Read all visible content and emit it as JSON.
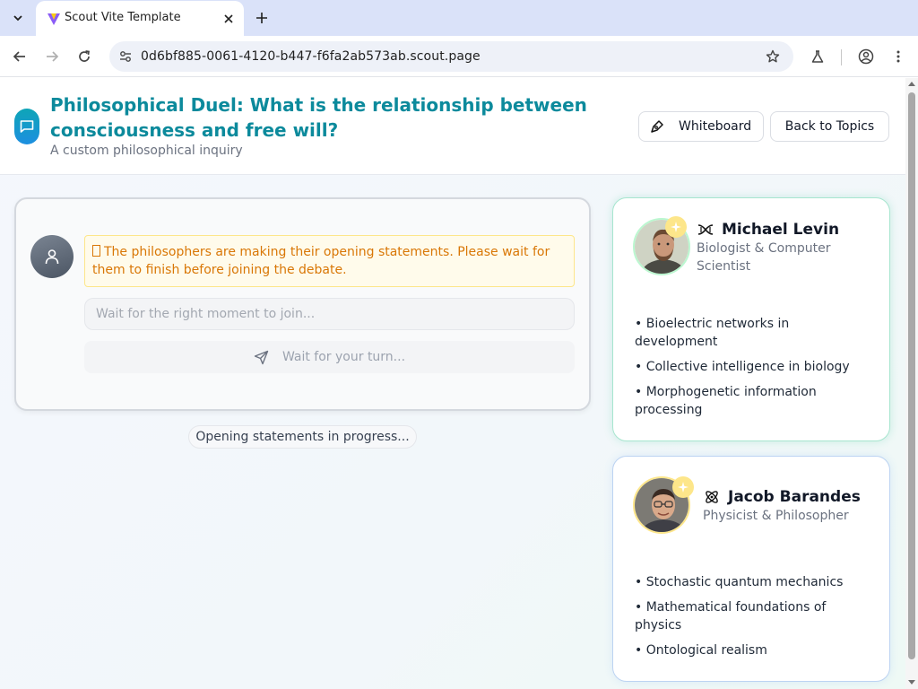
{
  "browser": {
    "tab_title": "Scout Vite Template",
    "url": "0d6bf885-0061-4120-b447-f6fa2ab573ab.scout.page"
  },
  "header": {
    "title": "Philosophical Duel: What is the relationship between consciousness and free will?",
    "subtitle": "A custom philosophical inquiry",
    "whiteboard_label": "Whiteboard",
    "back_label": "Back to Topics"
  },
  "chat": {
    "notice": "The philosophers are making their opening statements. Please wait for them to finish before joining the debate.",
    "input_placeholder": "Wait for the right moment to join...",
    "send_label": "Wait for your turn...",
    "status": "Opening statements in progress..."
  },
  "philosophers": [
    {
      "name": "Michael Levin",
      "role": "Biologist & Computer Scientist",
      "icon": "dna-icon",
      "accent": "#a7e6cf",
      "interests": [
        "• Bioelectric networks in development",
        "• Collective intelligence in biology",
        "• Morphogenetic information processing"
      ]
    },
    {
      "name": "Jacob Barandes",
      "role": "Physicist & Philosopher",
      "icon": "atom-icon",
      "accent": "#bcd3f2",
      "interests": [
        "• Stochastic quantum mechanics",
        "• Mathematical foundations of physics",
        "• Ontological realism"
      ]
    }
  ],
  "colors": {
    "title": "#0c8a9c",
    "notice_text": "#d97706",
    "notice_bg": "#fffbeb"
  }
}
